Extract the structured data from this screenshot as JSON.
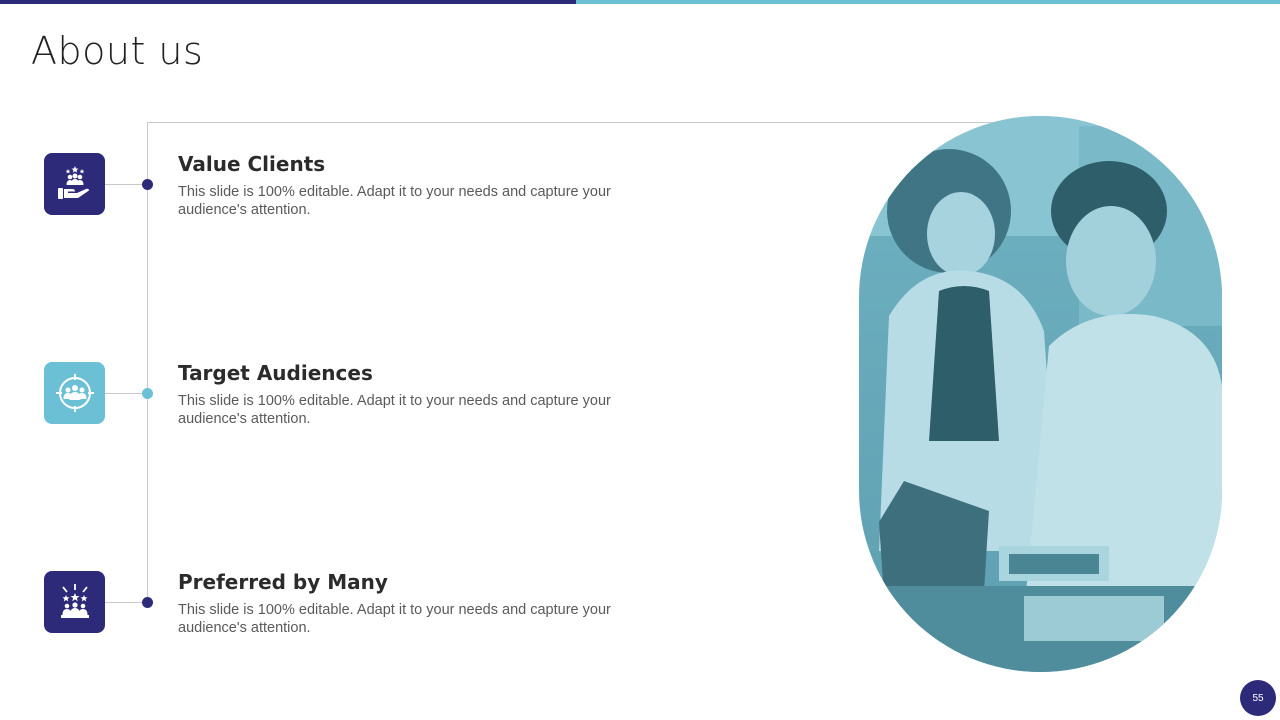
{
  "slide": {
    "title": "About us",
    "page_number": "55"
  },
  "items": [
    {
      "heading": "Value Clients",
      "description": "This slide is 100% editable. Adapt it to your needs and capture your audience's attention.",
      "icon": "hand-holding-people-icon"
    },
    {
      "heading": "Target Audiences",
      "description": "This slide is 100% editable. Adapt it to your needs and capture your audience's attention.",
      "icon": "target-audience-icon"
    },
    {
      "heading": "Preferred by Many",
      "description": "This slide is 100% editable. Adapt it to your needs and capture your audience's attention.",
      "icon": "star-audience-icon"
    }
  ],
  "colors": {
    "primary": "#2e2a7a",
    "accent": "#6cc0d6",
    "photo_tint": "#7bbccb"
  }
}
